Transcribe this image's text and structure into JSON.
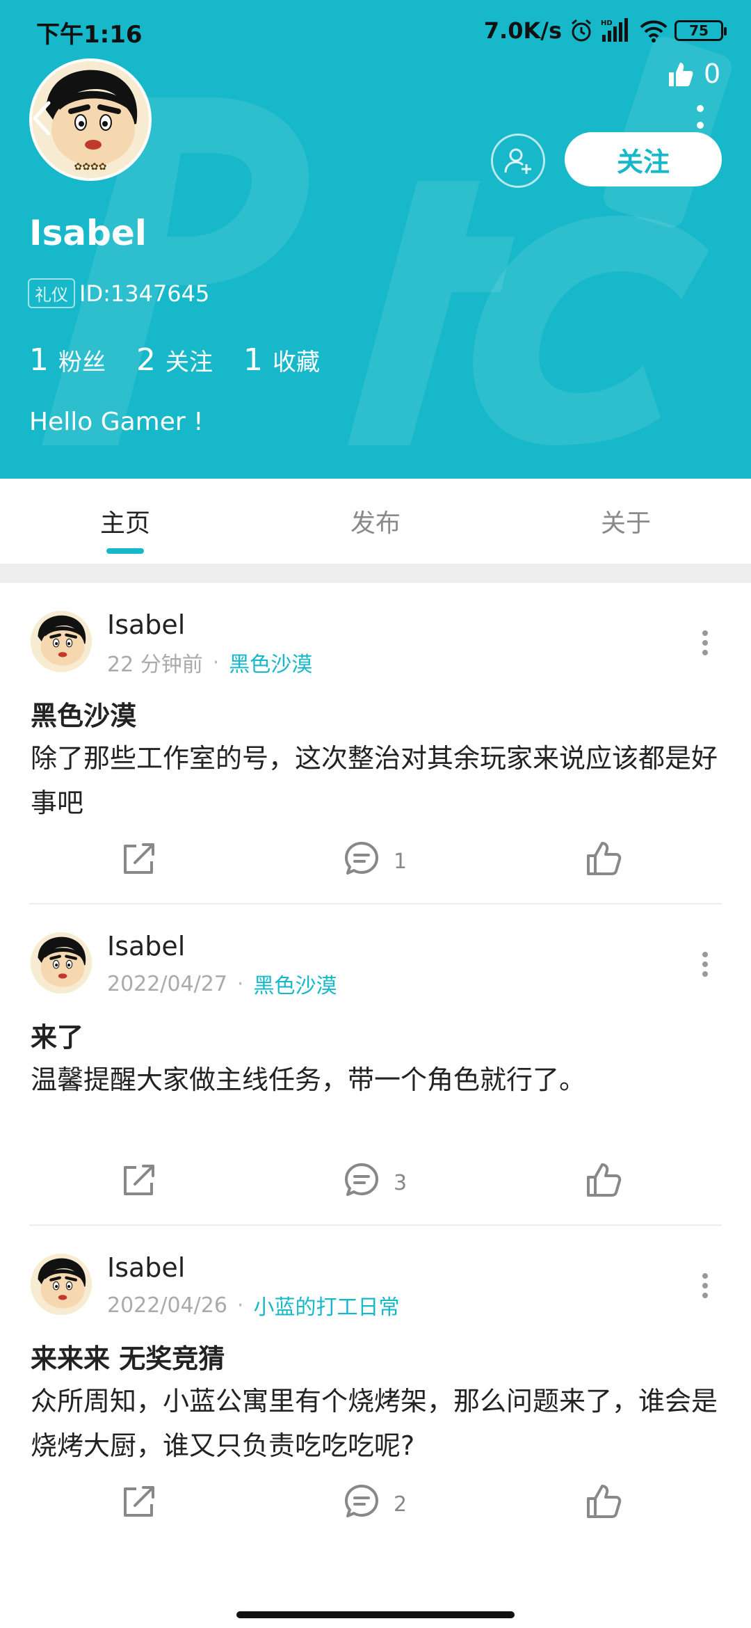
{
  "status_bar": {
    "time": "下午1:16",
    "speed": "7.0K/s",
    "battery": "75"
  },
  "profile": {
    "likes": "0",
    "follow_label": "关注",
    "name": "Isabel",
    "badge": "礼仪",
    "id": "ID:1347645",
    "stats": [
      {
        "num": "1",
        "label": "粉丝"
      },
      {
        "num": "2",
        "label": "关注"
      },
      {
        "num": "1",
        "label": "收藏"
      }
    ],
    "bio": "Hello Gamer !"
  },
  "tabs": [
    {
      "label": "主页",
      "active": true
    },
    {
      "label": "发布",
      "active": false
    },
    {
      "label": "关于",
      "active": false
    }
  ],
  "posts": [
    {
      "author": "Isabel",
      "time": "22 分钟前",
      "topic": "黑色沙漠",
      "title": "黑色沙漠",
      "body": "除了那些工作室的号，这次整治对其余玩家来说应该都是好事吧",
      "comments": "1"
    },
    {
      "author": "Isabel",
      "time": "2022/04/27",
      "topic": "黑色沙漠",
      "title": "来了",
      "body": "温馨提醒大家做主线任务，带一个角色就行了。",
      "comments": "3"
    },
    {
      "author": "Isabel",
      "time": "2022/04/26",
      "topic": "小蓝的打工日常",
      "title": "来来来 无奖竞猜",
      "body": "众所周知，小蓝公寓里有个烧烤架，那么问题来了，谁会是烧烤大厨，谁又只负责吃吃吃呢?",
      "comments": "2"
    }
  ],
  "colors": {
    "accent": "#16b8c9",
    "header_bg": "#16b8c9"
  }
}
